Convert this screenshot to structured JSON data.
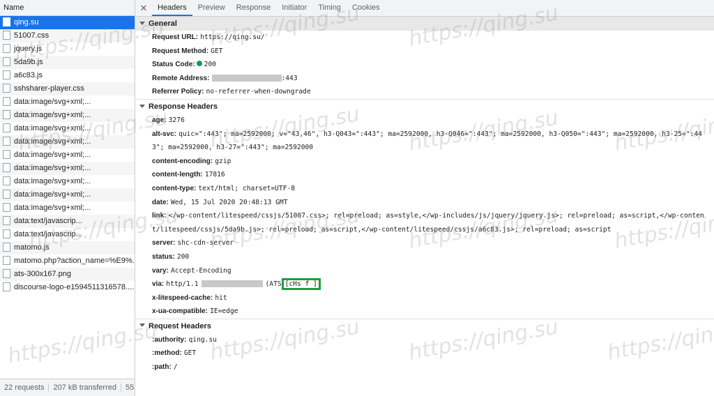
{
  "left": {
    "header": "Name",
    "requests": [
      {
        "label": "qing.su",
        "selected": true
      },
      {
        "label": "51007.css"
      },
      {
        "label": "jquery.js"
      },
      {
        "label": "5da9b.js"
      },
      {
        "label": "a6c83.js"
      },
      {
        "label": "sshsharer-player.css"
      },
      {
        "label": "data:image/svg+xml;..."
      },
      {
        "label": "data:image/svg+xml;..."
      },
      {
        "label": "data:image/svg+xml;..."
      },
      {
        "label": "data:image/svg+xml;..."
      },
      {
        "label": "data:image/svg+xml;..."
      },
      {
        "label": "data:image/svg+xml;..."
      },
      {
        "label": "data:image/svg+xml;..."
      },
      {
        "label": "data:image/svg+xml;..."
      },
      {
        "label": "data:image/svg+xml;..."
      },
      {
        "label": "data:text/javascrip..."
      },
      {
        "label": "data:text/javascrip..."
      },
      {
        "label": "matomo.js"
      },
      {
        "label": "matomo.php?action_name=%E9%..."
      },
      {
        "label": "ats-300x167.png"
      },
      {
        "label": "discourse-logo-e1594511316578...."
      }
    ],
    "footer": {
      "requests": "22 requests",
      "transferred": "207 kB transferred",
      "partial": "55"
    }
  },
  "tabs": [
    "Headers",
    "Preview",
    "Response",
    "Initiator",
    "Timing",
    "Cookies"
  ],
  "close_glyph": "✕",
  "general": {
    "title": "General",
    "request_url": {
      "key": "Request URL:",
      "value": "https://qing.su/"
    },
    "request_method": {
      "key": "Request Method:",
      "value": "GET"
    },
    "status_code": {
      "key": "Status Code:",
      "value": "200"
    },
    "remote_address": {
      "key": "Remote Address:",
      "value": ":443"
    },
    "referrer_policy": {
      "key": "Referrer Policy:",
      "value": "no-referrer-when-downgrade"
    }
  },
  "response": {
    "title": "Response Headers",
    "age": {
      "key": "age:",
      "value": "3276"
    },
    "alt_svc": {
      "key": "alt-svc:",
      "value": "quic=\":443\"; ma=2592000; v=\"43,46\", h3-Q043=\":443\"; ma=2592000, h3-Q046=\":443\"; ma=2592000, h3-Q050=\":443\"; ma=2592000, h3-25=\":443\"; ma=2592000, h3-27=\":443\"; ma=2592000"
    },
    "content_encoding": {
      "key": "content-encoding:",
      "value": "gzip"
    },
    "content_length": {
      "key": "content-length:",
      "value": "17816"
    },
    "content_type": {
      "key": "content-type:",
      "value": "text/html; charset=UTF-8"
    },
    "date": {
      "key": "date:",
      "value": "Wed, 15 Jul 2020 20:48:13 GMT"
    },
    "link": {
      "key": "link:",
      "value": "</wp-content/litespeed/cssjs/51007.css>; rel=preload; as=style,</wp-includes/js/jquery/jquery.js>; rel=preload; as=script,</wp-content/litespeed/cssjs/5da9b.js>; rel=preload; as=script,</wp-content/litespeed/cssjs/a6c83.js>; rel=preload; as=script"
    },
    "server": {
      "key": "server:",
      "value": "shc-cdn-server"
    },
    "status": {
      "key": "status:",
      "value": "200"
    },
    "vary": {
      "key": "vary:",
      "value": "Accept-Encoding"
    },
    "via": {
      "key": "via:",
      "value_prefix": "http/1.1",
      "value_mid": "(ATS",
      "value_highlight": "[cHs f ]"
    },
    "x_litespeed_cache": {
      "key": "x-litespeed-cache:",
      "value": "hit"
    },
    "x_ua_compatible": {
      "key": "x-ua-compatible:",
      "value": "IE=edge"
    }
  },
  "request": {
    "title": "Request Headers",
    "authority": {
      "key": ":authority:",
      "value": "qing.su"
    },
    "method": {
      "key": ":method:",
      "value": "GET"
    },
    "path": {
      "key": ":path:",
      "value": "/"
    }
  },
  "watermark": "https://qing.su",
  "colors": {
    "selected": "#1a73e8",
    "status_ok": "#0f9d58",
    "highlight_box": "#1e9e3a"
  }
}
